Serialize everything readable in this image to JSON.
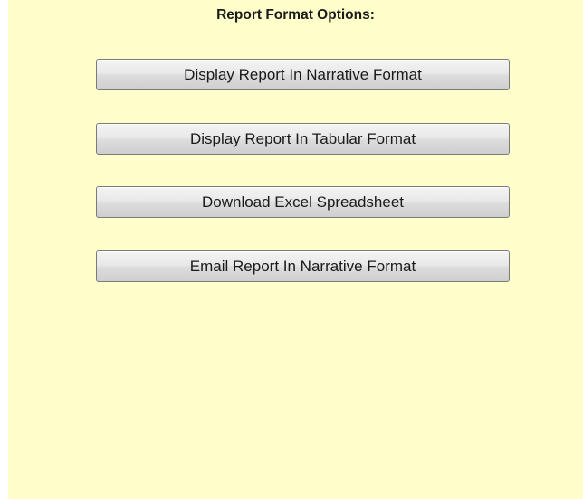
{
  "header": {
    "title": "Report Format Options:"
  },
  "buttons": [
    {
      "label": "Display Report In Narrative Format"
    },
    {
      "label": "Display Report In Tabular Format"
    },
    {
      "label": "Download Excel Spreadsheet"
    },
    {
      "label": "Email Report In Narrative Format"
    }
  ],
  "colors": {
    "panel_background": "#ffffcc",
    "button_border": "#7a7a7a"
  }
}
